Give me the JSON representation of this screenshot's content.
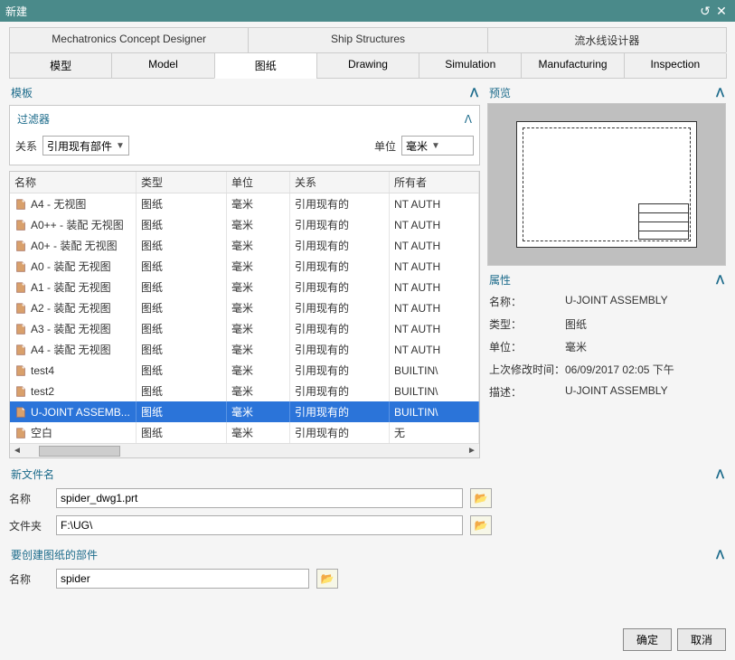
{
  "window": {
    "title": "新建",
    "reset_icon": "↺",
    "close_icon": "✕"
  },
  "top_tabs": [
    {
      "label": "Mechatronics Concept Designer"
    },
    {
      "label": "Ship Structures"
    },
    {
      "label": "流水线设计器"
    }
  ],
  "sub_tabs": [
    {
      "label": "模型"
    },
    {
      "label": "Model"
    },
    {
      "label": "图纸",
      "active": true
    },
    {
      "label": "Drawing"
    },
    {
      "label": "Simulation"
    },
    {
      "label": "Manufacturing"
    },
    {
      "label": "Inspection"
    }
  ],
  "templates": {
    "header": "模板",
    "filter": {
      "header": "过滤器",
      "relation_label": "关系",
      "relation_value": "引用现有部件",
      "unit_label": "单位",
      "unit_value": "毫米"
    },
    "columns": {
      "name": "名称",
      "type": "类型",
      "unit": "单位",
      "relation": "关系",
      "owner": "所有者"
    },
    "rows": [
      {
        "name": "A4 - 无视图",
        "type": "图纸",
        "unit": "毫米",
        "relation": "引用现有的",
        "owner": "NT AUTH"
      },
      {
        "name": "A0++ - 装配 无视图",
        "type": "图纸",
        "unit": "毫米",
        "relation": "引用现有的",
        "owner": "NT AUTH"
      },
      {
        "name": "A0+ - 装配 无视图",
        "type": "图纸",
        "unit": "毫米",
        "relation": "引用现有的",
        "owner": "NT AUTH"
      },
      {
        "name": "A0 - 装配 无视图",
        "type": "图纸",
        "unit": "毫米",
        "relation": "引用现有的",
        "owner": "NT AUTH"
      },
      {
        "name": "A1 - 装配 无视图",
        "type": "图纸",
        "unit": "毫米",
        "relation": "引用现有的",
        "owner": "NT AUTH"
      },
      {
        "name": "A2 - 装配 无视图",
        "type": "图纸",
        "unit": "毫米",
        "relation": "引用现有的",
        "owner": "NT AUTH"
      },
      {
        "name": "A3 - 装配 无视图",
        "type": "图纸",
        "unit": "毫米",
        "relation": "引用现有的",
        "owner": "NT AUTH"
      },
      {
        "name": "A4 - 装配 无视图",
        "type": "图纸",
        "unit": "毫米",
        "relation": "引用现有的",
        "owner": "NT AUTH"
      },
      {
        "name": "test4",
        "type": "图纸",
        "unit": "毫米",
        "relation": "引用现有的",
        "owner": "BUILTIN\\"
      },
      {
        "name": "test2",
        "type": "图纸",
        "unit": "毫米",
        "relation": "引用现有的",
        "owner": "BUILTIN\\"
      },
      {
        "name": "U-JOINT ASSEMB...",
        "type": "图纸",
        "unit": "毫米",
        "relation": "引用现有的",
        "owner": "BUILTIN\\",
        "selected": true
      },
      {
        "name": "空白",
        "type": "图纸",
        "unit": "毫米",
        "relation": "引用现有的",
        "owner": "无"
      }
    ]
  },
  "preview": {
    "header": "预览"
  },
  "properties": {
    "header": "属性",
    "items": [
      {
        "k": "名称：",
        "v": "U-JOINT ASSEMBLY"
      },
      {
        "k": "类型：",
        "v": "图纸"
      },
      {
        "k": "单位：",
        "v": "毫米"
      },
      {
        "k": "上次修改时间：",
        "v": "06/09/2017 02:05 下午"
      },
      {
        "k": "描述：",
        "v": "U-JOINT ASSEMBLY"
      }
    ]
  },
  "new_file": {
    "header": "新文件名",
    "name_label": "名称",
    "name_value": "spider_dwg1.prt",
    "folder_label": "文件夹",
    "folder_value": "F:\\UG\\"
  },
  "create_part": {
    "header": "要创建图纸的部件",
    "name_label": "名称",
    "name_value": "spider"
  },
  "footer": {
    "ok": "确定",
    "cancel": "取消"
  },
  "chevron": "ᐱ"
}
